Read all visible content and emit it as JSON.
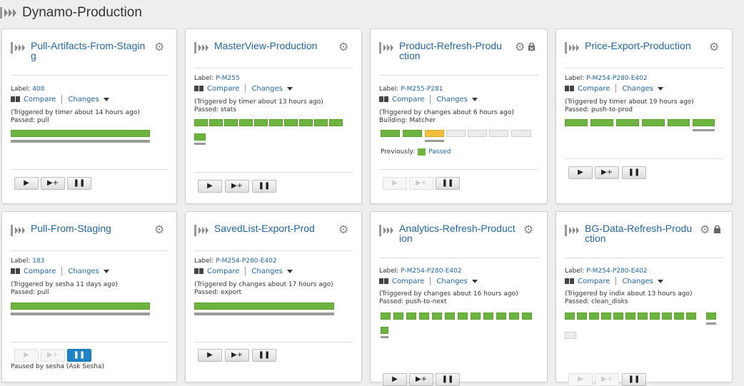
{
  "page": {
    "title": "Dynamo-Production"
  },
  "colors": {
    "passed": "#6db33f",
    "building": "#f2c13c",
    "link": "#2266aa"
  },
  "pipelines": [
    {
      "name": "Pull-Artifacts-From-Stagin g",
      "label_prefix": "Label:",
      "label": "408",
      "compare": "Compare",
      "changes": "Changes",
      "trigger": "(Triggered by timer about 14 hours ago)",
      "stage_status": "Passed: pull"
    },
    {
      "name": "MasterView-Production",
      "label_prefix": "Label:",
      "label": "P-M255",
      "compare": "Compare",
      "changes": "Changes",
      "trigger": "(Triggered by timer about 13 hours ago)",
      "stage_status": "Passed: stats"
    },
    {
      "name": "Product-Refresh-Produ ction",
      "label_prefix": "Label:",
      "label": "P-M255-P281",
      "compare": "Compare",
      "changes": "Changes",
      "trigger": "(Triggered by changes about 6 hours ago)",
      "stage_status": "Building: Matcher",
      "previously_label": "Previously:",
      "previously_status": "Passed"
    },
    {
      "name": "Price-Export-Production",
      "label_prefix": "Label:",
      "label": "P-M254-P280-E402",
      "compare": "Compare",
      "changes": "Changes",
      "trigger": "(Triggered by timer about 19 hours ago)",
      "stage_status": "Passed: push-to-prod"
    },
    {
      "name": "Pull-From-Staging",
      "label_prefix": "Label:",
      "label": "183",
      "compare": "Compare",
      "changes": "Changes",
      "trigger": "(Triggered by sesha 11 days ago)",
      "stage_status": "Passed: pull",
      "paused_note": "Paused by sesha (Ask Sesha)"
    },
    {
      "name": "SavedList-Export-Prod",
      "label_prefix": "Label:",
      "label": "P-M254-P280-E402",
      "compare": "Compare",
      "changes": "Changes",
      "trigger": "(Triggered by changes about 17 hours ago)",
      "stage_status": "Passed: export"
    },
    {
      "name": "Analytics-Refresh-Product ion",
      "label_prefix": "Label:",
      "label": "P-M254-P280-E402",
      "compare": "Compare",
      "changes": "Changes",
      "trigger": "(Triggered by changes about 16 hours ago)",
      "stage_status": "Passed: push-to-next"
    },
    {
      "name": "BG-Data-Refresh-Produ ction",
      "label_prefix": "Label:",
      "label": "P-M254-P280-E402",
      "compare": "Compare",
      "changes": "Changes",
      "trigger": "(Triggered by indix about 13 hours ago)",
      "stage_status": "Passed: clean_disks"
    }
  ],
  "icons": {
    "play": "▶",
    "trigger_with_options": "▶+",
    "pause": "❚❚",
    "settings": "gear-icon",
    "lock": "lock-icon"
  }
}
